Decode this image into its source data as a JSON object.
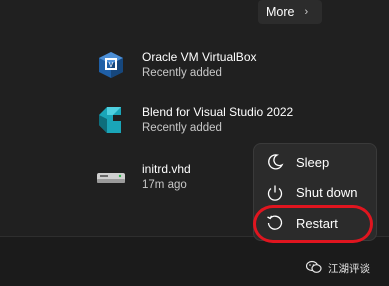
{
  "header": {
    "more_label": "More",
    "more_icon": "chevron-right-icon"
  },
  "recommended": [
    {
      "title": "Oracle VM VirtualBox",
      "subtitle": "Recently added",
      "icon": "virtualbox-icon"
    },
    {
      "title": "Blend for Visual Studio 2022",
      "subtitle": "Recently added",
      "icon": "blend-icon"
    },
    {
      "title": "initrd.vhd",
      "subtitle": "17m ago",
      "icon": "vhd-drive-icon"
    }
  ],
  "power_menu": {
    "items": [
      {
        "label": "Sleep",
        "icon": "moon-icon"
      },
      {
        "label": "Shut down",
        "icon": "power-icon"
      },
      {
        "label": "Restart",
        "icon": "restart-icon"
      }
    ],
    "highlight_color": "#e0151f"
  },
  "watermark": {
    "text": "江湖评谈"
  }
}
